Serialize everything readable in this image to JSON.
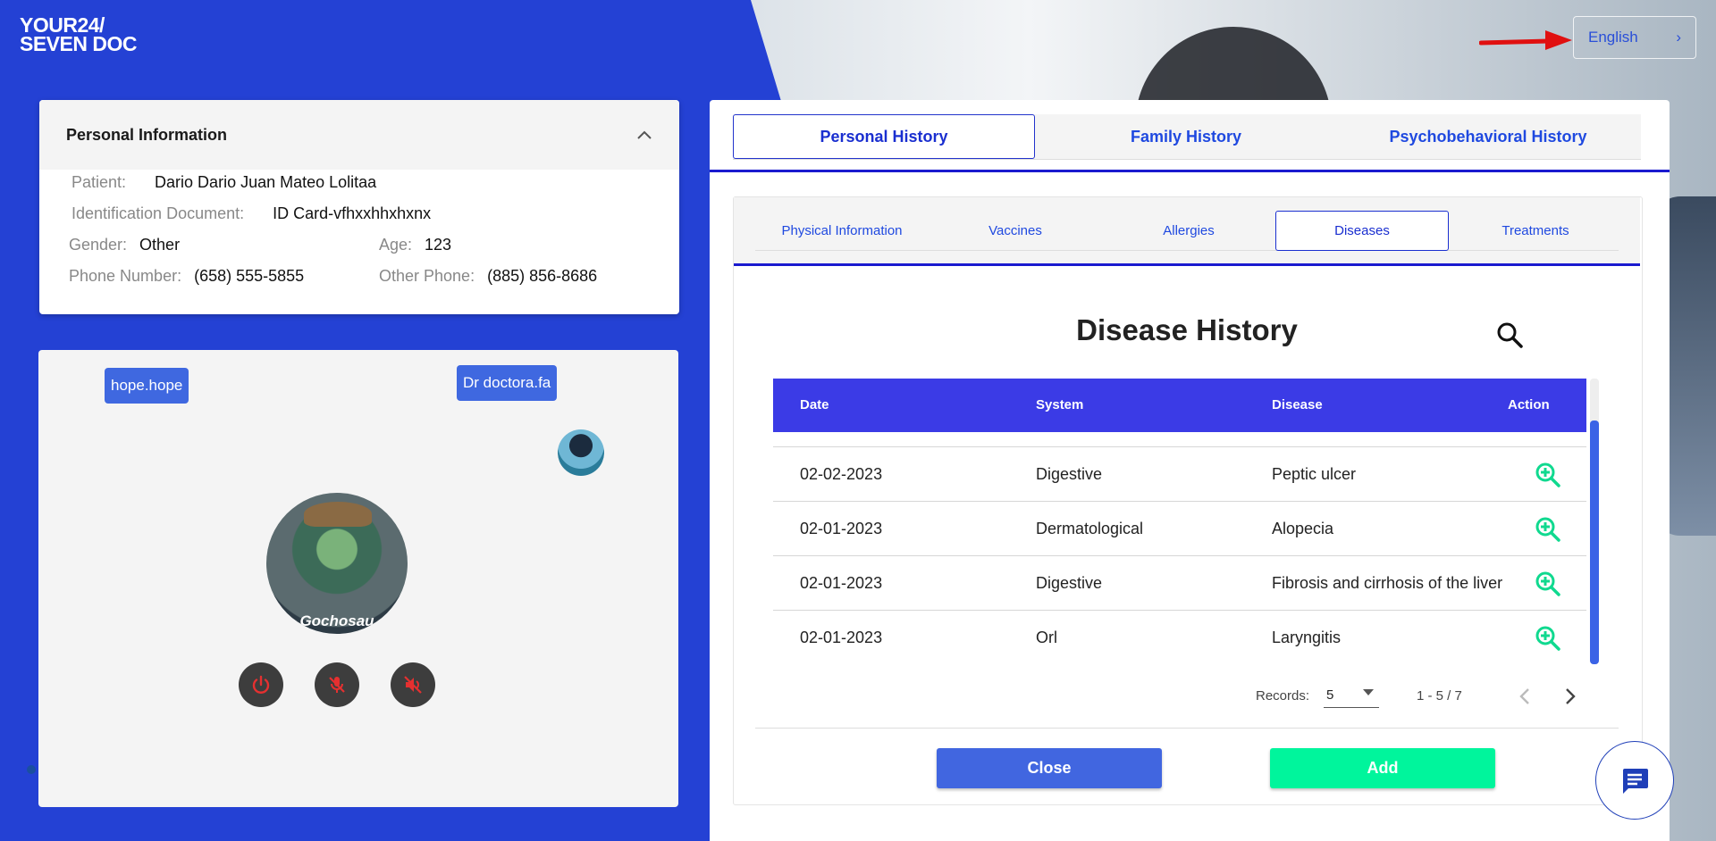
{
  "brand": {
    "line1": "YOUR24/",
    "line2": "SEVEN DOC"
  },
  "language": {
    "label": "English"
  },
  "personal_info": {
    "title": "Personal Information",
    "patient_label": "Patient:",
    "patient_value": "Dario Dario Juan Mateo Lolitaa",
    "id_label": "Identification Document:",
    "id_value": "ID Card-vfhxxhhxhxnx",
    "gender_label": "Gender:",
    "gender_value": "Other",
    "age_label": "Age:",
    "age_value": "123",
    "phone_label": "Phone Number:",
    "phone_value": "(658) 555-5855",
    "other_phone_label": "Other Phone:",
    "other_phone_value": "(885) 856-8686"
  },
  "video": {
    "participant_1": "hope.hope",
    "participant_2": "Dr doctora.fa",
    "avatar_caption": "Gochosau"
  },
  "main_tabs": [
    "Personal History",
    "Family History",
    "Psychobehavioral History"
  ],
  "sub_tabs": [
    "Physical Information",
    "Vaccines",
    "Allergies",
    "Diseases",
    "Treatments"
  ],
  "disease_history": {
    "title": "Disease History",
    "columns": [
      "Date",
      "System",
      "Disease",
      "Action"
    ],
    "rows": [
      {
        "date": "02-02-2023",
        "system": "Digestive",
        "disease": "Peptic ulcer"
      },
      {
        "date": "02-01-2023",
        "system": "Dermatological",
        "disease": "Alopecia"
      },
      {
        "date": "02-01-2023",
        "system": "Digestive",
        "disease": "Fibrosis and cirrhosis of the liver"
      },
      {
        "date": "02-01-2023",
        "system": "Orl",
        "disease": "Laryngitis"
      }
    ]
  },
  "pagination": {
    "records_label": "Records:",
    "records_value": "5",
    "range": "1 - 5 / 7"
  },
  "buttons": {
    "close": "Close",
    "add": "Add"
  },
  "colors": {
    "brand_blue": "#2441d4",
    "accent_green": "#00f59c",
    "close_blue": "#4166e0",
    "table_header": "#3b3be6"
  }
}
